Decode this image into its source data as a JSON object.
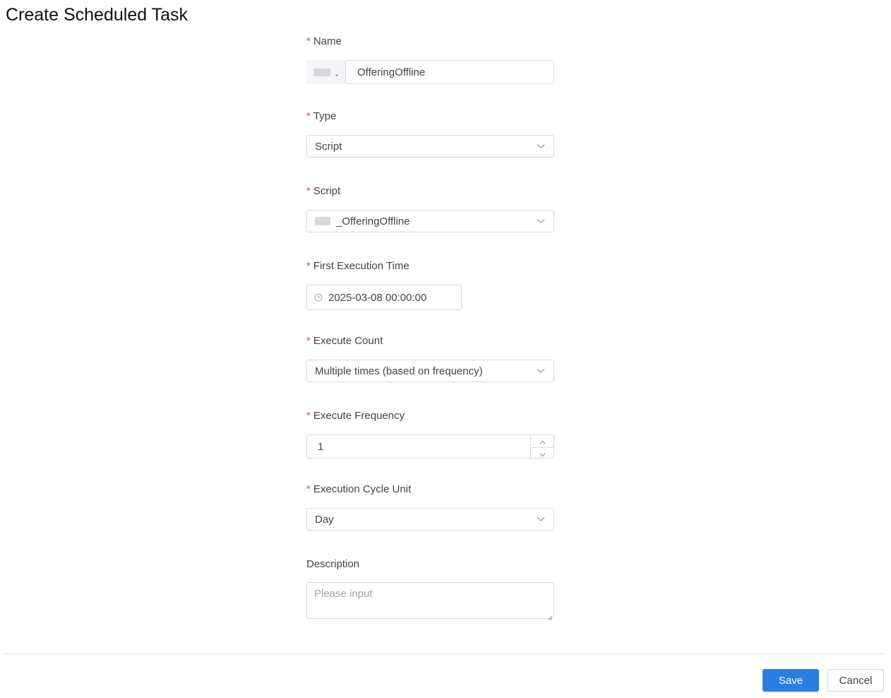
{
  "page": {
    "title": "Create Scheduled Task"
  },
  "form": {
    "required_mark": "*",
    "name": {
      "label": "Name",
      "prefix_separator": "-",
      "value": "OfferingOffline"
    },
    "type": {
      "label": "Type",
      "value": "Script"
    },
    "script": {
      "label": "Script",
      "value": "_OfferingOffline"
    },
    "first_execution_time": {
      "label": "First Execution Time",
      "value": "2025-03-08 00:00:00"
    },
    "execute_count": {
      "label": "Execute Count",
      "value": "Multiple times (based on frequency)"
    },
    "execute_frequency": {
      "label": "Execute Frequency",
      "value": "1"
    },
    "execution_cycle_unit": {
      "label": "Execution Cycle Unit",
      "value": "Day"
    },
    "description": {
      "label": "Description",
      "placeholder": "Please input"
    }
  },
  "footer": {
    "save_label": "Save",
    "cancel_label": "Cancel"
  },
  "colors": {
    "primary": "#2a7de1",
    "required": "#e34d4d",
    "border": "#d5d8de"
  }
}
